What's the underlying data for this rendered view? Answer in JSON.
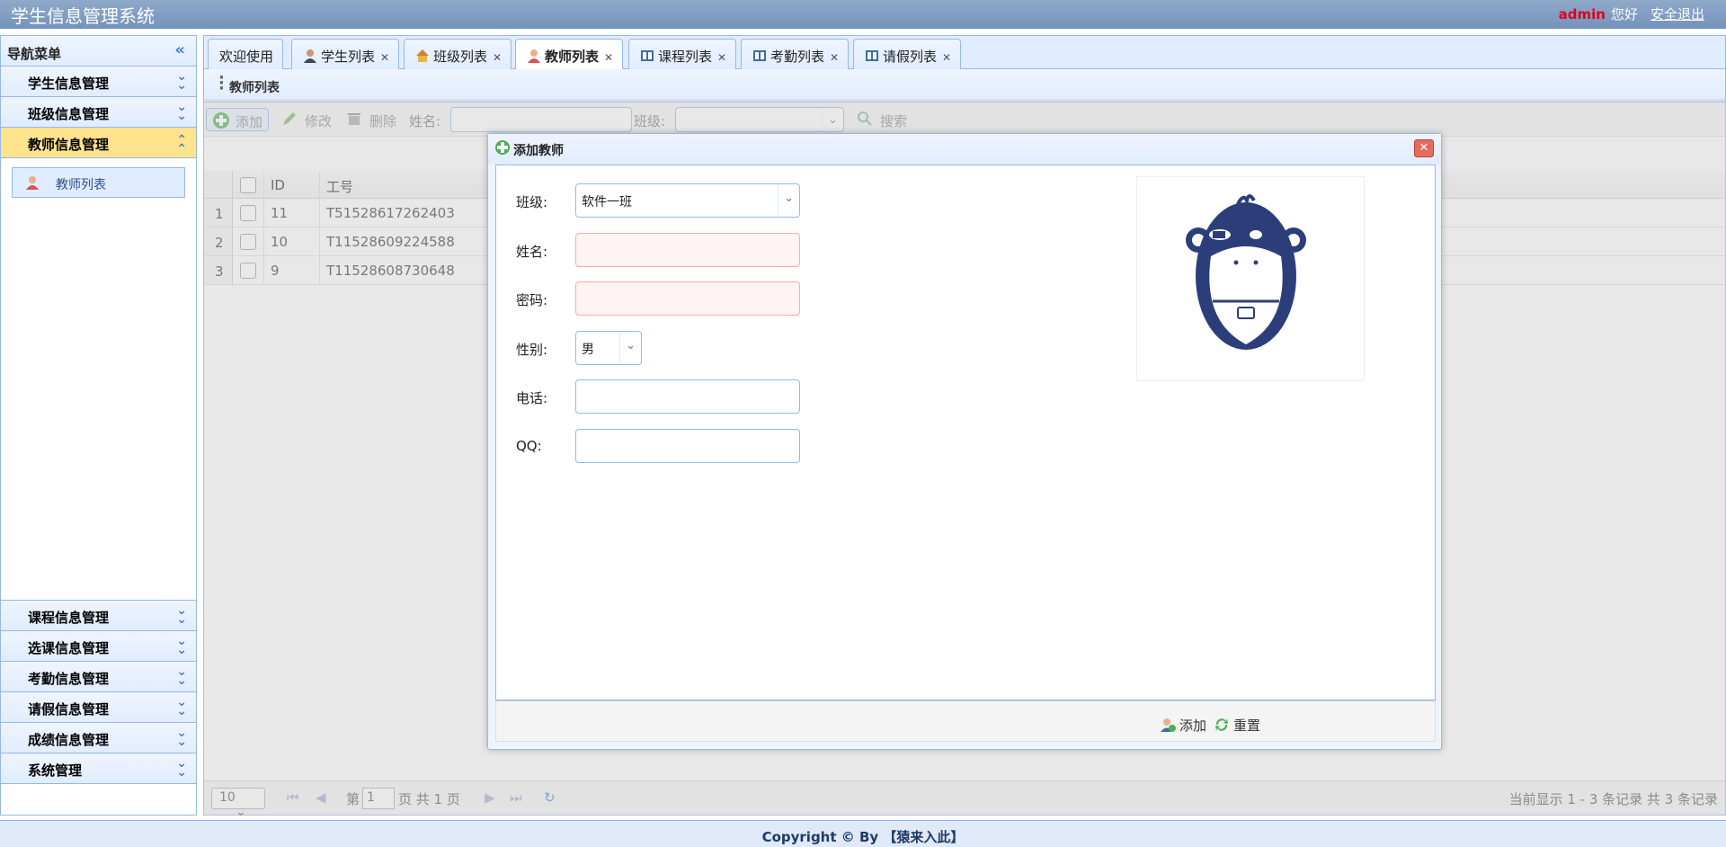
{
  "header": {
    "title": "学生信息管理系统",
    "user": "admin",
    "greeting": "您好",
    "logout": "安全退出"
  },
  "sidebar": {
    "title": "导航菜单",
    "top_items": [
      {
        "label": "学生信息管理"
      },
      {
        "label": "班级信息管理"
      },
      {
        "label": "教师信息管理"
      }
    ],
    "sub_items": [
      {
        "label": "教师列表"
      }
    ],
    "bottom_items": [
      {
        "label": "课程信息管理"
      },
      {
        "label": "选课信息管理"
      },
      {
        "label": "考勤信息管理"
      },
      {
        "label": "请假信息管理"
      },
      {
        "label": "成绩信息管理"
      },
      {
        "label": "系统管理"
      }
    ]
  },
  "tabs": [
    {
      "label": "欢迎使用"
    },
    {
      "label": "学生列表"
    },
    {
      "label": "班级列表"
    },
    {
      "label": "教师列表"
    },
    {
      "label": "课程列表"
    },
    {
      "label": "考勤列表"
    },
    {
      "label": "请假列表"
    }
  ],
  "panel": {
    "title": "教师列表"
  },
  "toolbar": {
    "add": "添加",
    "edit": "修改",
    "delete": "删除",
    "name_label": "姓名:",
    "class_label": "班级:",
    "search": "搜索"
  },
  "grid": {
    "columns": {
      "id": "ID",
      "worknum": "工号"
    },
    "rows": [
      {
        "n": "1",
        "id": "11",
        "worknum": "T51528617262403"
      },
      {
        "n": "2",
        "id": "10",
        "worknum": "T11528609224588"
      },
      {
        "n": "3",
        "id": "9",
        "worknum": "T11528608730648"
      }
    ]
  },
  "pager": {
    "page_size": "10",
    "page_prefix": "第",
    "page_value": "1",
    "page_suffix": "页 共 1 页",
    "summary": "当前显示 1 - 3 条记录 共 3 条记录"
  },
  "dialog": {
    "title": "添加教师",
    "class_label": "班级:",
    "class_value": "软件一班",
    "name_label": "姓名:",
    "password_label": "密码:",
    "gender_label": "性别:",
    "gender_value": "男",
    "phone_label": "电话:",
    "qq_label": "QQ:",
    "add": "添加",
    "reset": "重置"
  },
  "footer": {
    "text": "Copyright © By 【猿来入此】"
  }
}
